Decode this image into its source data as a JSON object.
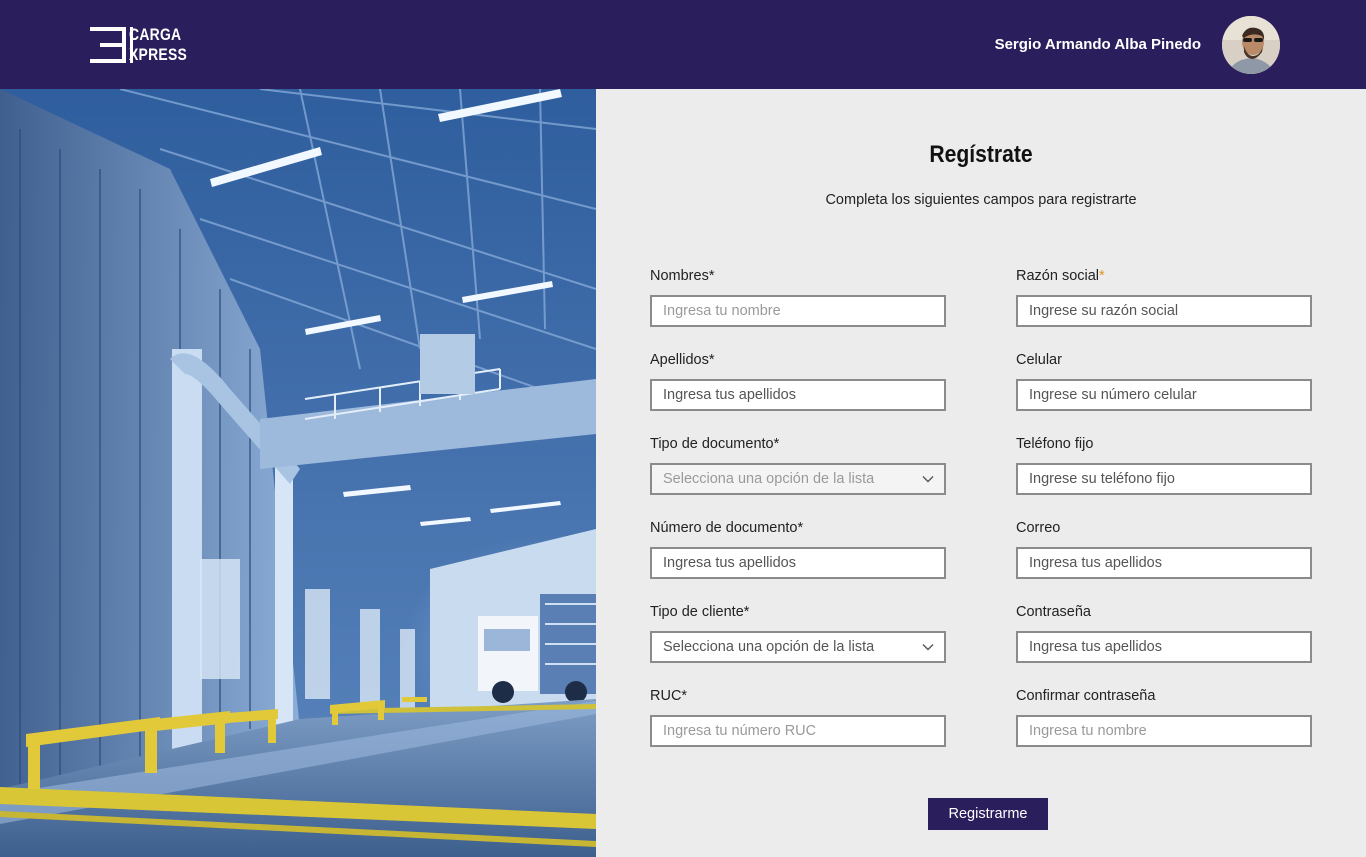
{
  "header": {
    "logo_line1": "CARGA",
    "logo_line2": "XPRESS",
    "user_name": "Sergio Armando Alba Pinedo",
    "brand_color": "#2a1f5c"
  },
  "form": {
    "title": "Regístrate",
    "subtitle": "Completa los siguientes campos para registrarte",
    "left": [
      {
        "label": "Nombres*",
        "placeholder": "Ingresa tu nombre",
        "type": "text"
      },
      {
        "label": "Apellidos*",
        "placeholder": "Ingresa tus apellidos",
        "type": "text"
      },
      {
        "label": "Tipo de documento*",
        "placeholder": "Selecciona una opción de la lista",
        "type": "select"
      },
      {
        "label": "Número de documento*",
        "placeholder": "Ingresa tus apellidos",
        "type": "text"
      },
      {
        "label": "Tipo de cliente*",
        "placeholder": "Selecciona una opción de la lista",
        "type": "select"
      },
      {
        "label": "RUC*",
        "placeholder": "Ingresa tu número RUC",
        "type": "text"
      }
    ],
    "right": [
      {
        "label": "Razón social",
        "required_mark": "*",
        "placeholder": "Ingrese su razón social",
        "type": "text"
      },
      {
        "label": "Celular",
        "placeholder": "Ingrese su número celular",
        "type": "text"
      },
      {
        "label": "Teléfono fijo",
        "placeholder": "Ingrese su teléfono fijo",
        "type": "text"
      },
      {
        "label": "Correo",
        "placeholder": "Ingresa tus apellidos",
        "type": "text"
      },
      {
        "label": "Contraseña",
        "placeholder": "Ingresa tus apellidos",
        "type": "text"
      },
      {
        "label": "Confirmar contraseña",
        "placeholder": "Ingresa tu nombre",
        "type": "text"
      }
    ],
    "submit_label": "Registrarme"
  }
}
